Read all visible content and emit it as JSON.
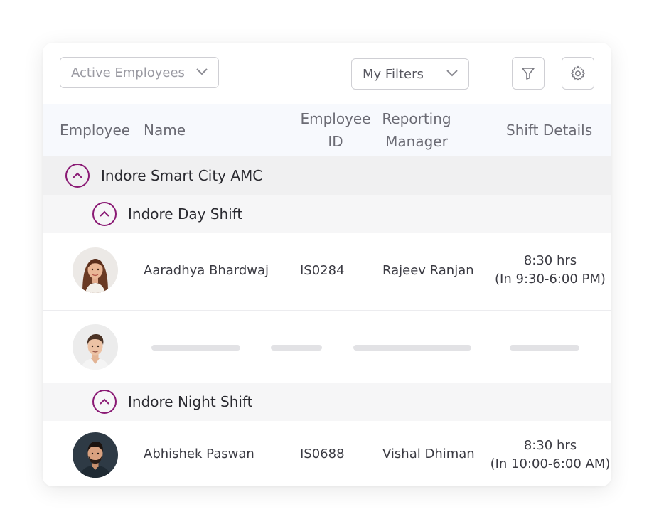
{
  "toolbar": {
    "status_select": {
      "value": "Active Employees"
    },
    "filters_select": {
      "value": "My Filters"
    },
    "filter_icon": "filter-icon",
    "settings_icon": "gear-icon"
  },
  "table": {
    "headers": {
      "employee": "Employee",
      "name": "Name",
      "employee_id_line1": "Employee",
      "employee_id_line2": "ID",
      "manager_line1": "Reporting",
      "manager_line2": "Manager",
      "shift": "Shift Details"
    },
    "groups": {
      "city": "Indore Smart City AMC",
      "day_shift": "Indore Day Shift",
      "night_shift": "Indore Night Shift"
    },
    "rows": [
      {
        "name": "Aaradhya Bhardwaj",
        "employee_id": "IS0284",
        "manager": "Rajeev Ranjan",
        "shift_hours": "8:30 hrs",
        "shift_range": "(In 9:30-6:00 PM)"
      },
      {
        "name": "Abhishek Paswan",
        "employee_id": "IS0688",
        "manager": "Vishal Dhiman",
        "shift_hours": "8:30 hrs",
        "shift_range": "(In 10:00-6:00 AM)"
      }
    ]
  },
  "colors": {
    "accent": "#8a1a74",
    "header_bg": "#f7f9fd",
    "group_bg": "#f0f0f1",
    "subgroup_bg": "#f6f6f7"
  }
}
